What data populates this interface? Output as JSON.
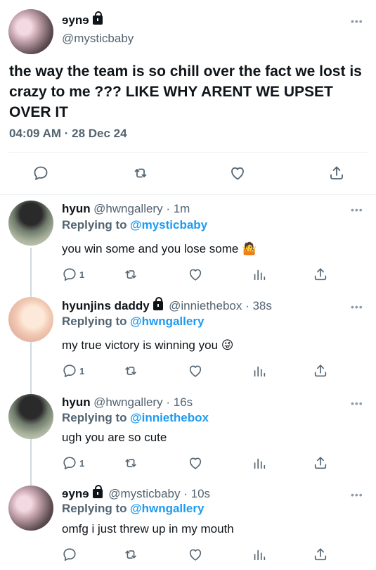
{
  "main_tweet": {
    "name": "ɘynɘ",
    "handle": "@mysticbaby",
    "text": "the way the team is so chill over the fact we lost is crazy to me ??? LIKE WHY ARENT WE UPSET OVER IT",
    "time": "04:09 AM · 28 Dec 24",
    "more": "•••"
  },
  "replies": [
    {
      "name": "hyun",
      "handle": "@hwngallery",
      "time_sep": " · ",
      "time": "1m",
      "replying_label": "Replying to",
      "replying_to": "@mysticbaby",
      "text": "you win some and you lose some 🤷",
      "reply_count": "1",
      "more": "•••"
    },
    {
      "name": "hyunjins daddy",
      "handle": "@inniethebox",
      "time_sep": " · ",
      "time": "38s",
      "replying_label": "Replying to",
      "replying_to": "@hwngallery",
      "text": "my true victory is winning you 😜",
      "reply_count": "1",
      "more": "•••"
    },
    {
      "name": "hyun",
      "handle": "@hwngallery",
      "time_sep": " · ",
      "time": "16s",
      "replying_label": "Replying to",
      "replying_to": "@inniethebox",
      "text": "ugh you are so cute",
      "reply_count": "1",
      "more": "•••"
    },
    {
      "name": "ɘynɘ",
      "handle": "@mysticbaby",
      "time_sep": " · ",
      "time": "10s",
      "replying_label": "Replying to",
      "replying_to": "@hwngallery",
      "text": "omfg i just threw up in my mouth",
      "reply_count": "",
      "more": "•••"
    }
  ],
  "icons": [
    "reply-icon",
    "retweet-icon",
    "like-icon",
    "analytics-icon",
    "share-icon",
    "lock-icon",
    "more-icon"
  ],
  "colors": {
    "link": "#1d9bf0",
    "secondary": "#536471",
    "icon": "#536471",
    "text": "#0f1419"
  }
}
